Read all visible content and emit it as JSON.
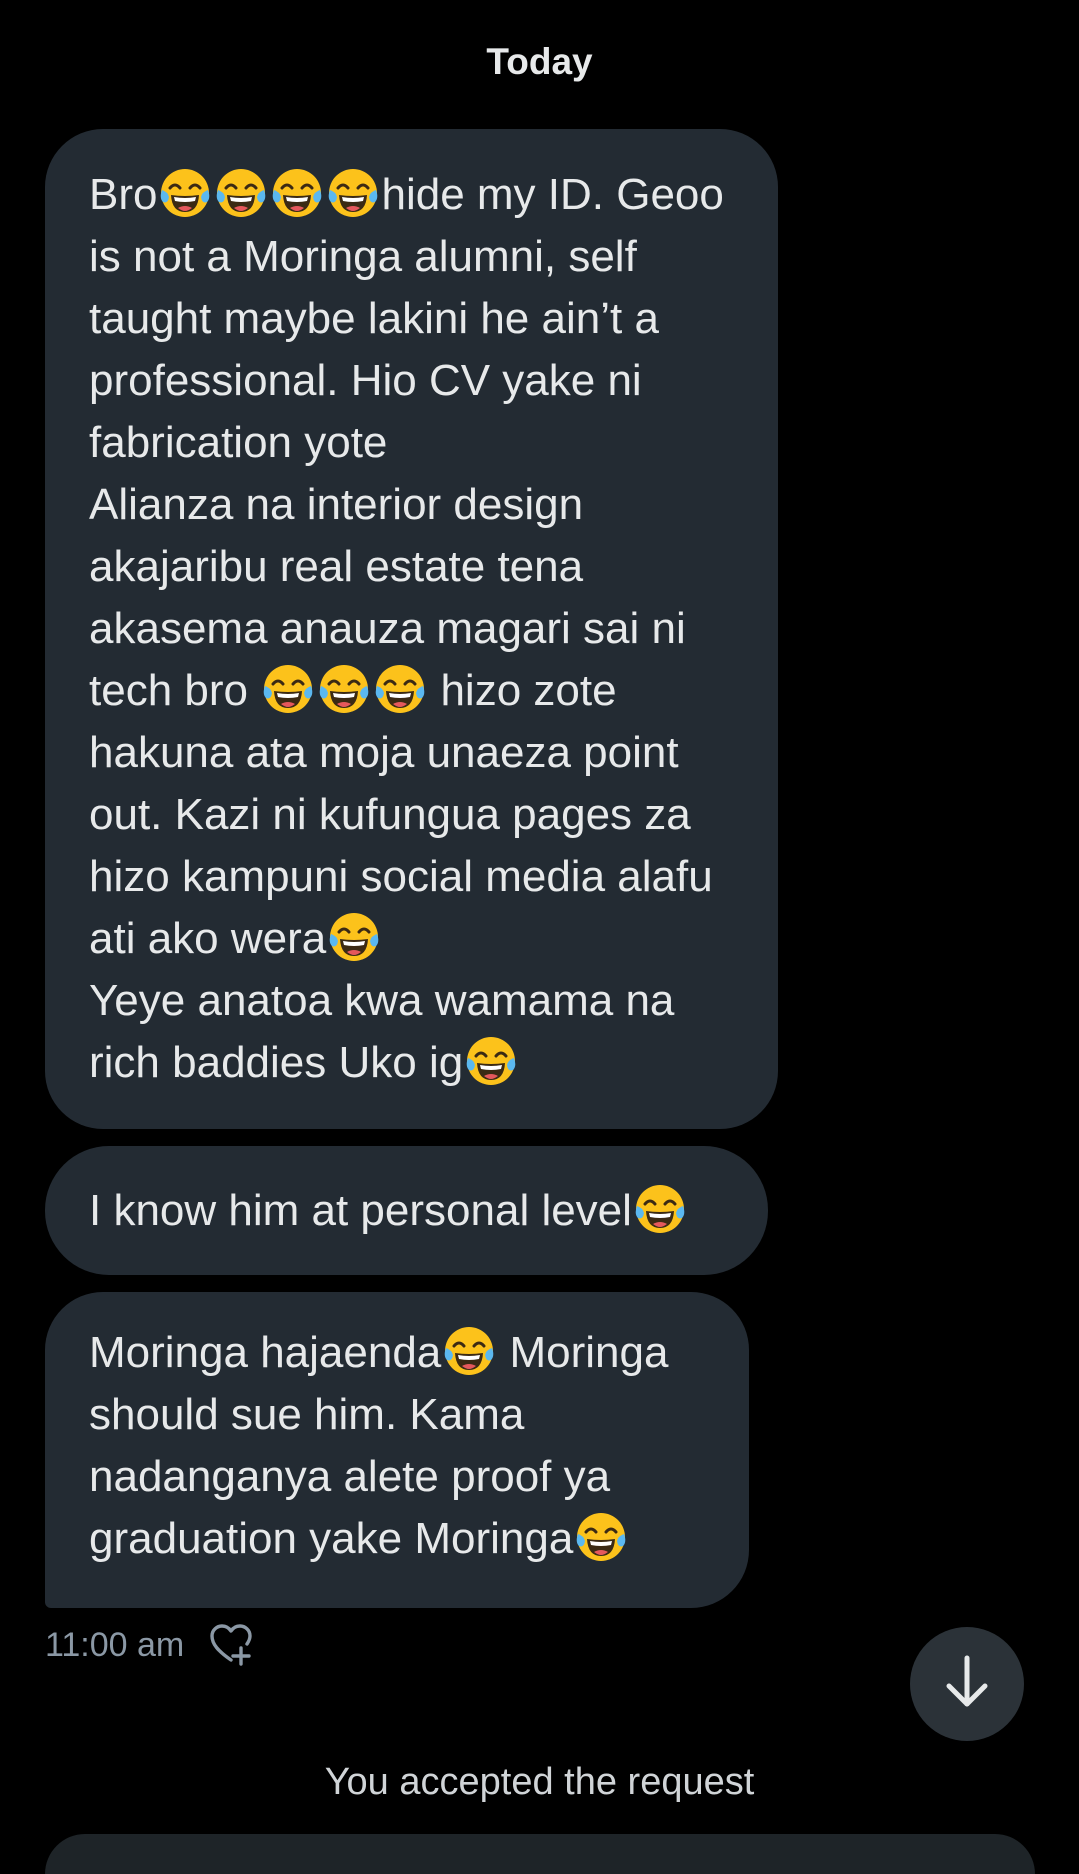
{
  "conversation": {
    "date_header": "Today",
    "messages": [
      {
        "id": "msg-1",
        "segments": [
          {
            "t": "text",
            "v": "Bro"
          },
          {
            "t": "emoji"
          },
          {
            "t": "emoji"
          },
          {
            "t": "emoji"
          },
          {
            "t": "emoji"
          },
          {
            "t": "text",
            "v": "hide my ID. Geoo is not a Moringa alumni, self taught maybe lakini he ain’t a professional. Hio CV yake ni fabrication yote\nAlianza na interior design akajaribu real estate tena akasema anauza magari sai ni tech bro "
          },
          {
            "t": "emoji"
          },
          {
            "t": "emoji"
          },
          {
            "t": "emoji"
          },
          {
            "t": "text",
            "v": " hizo zote hakuna ata moja unaeza point out. Kazi ni kufungua pages za hizo kampuni social media alafu ati ako wera"
          },
          {
            "t": "emoji"
          },
          {
            "t": "text",
            "v": "\nYeye anatoa kwa wamama na rich baddies Uko ig"
          },
          {
            "t": "emoji"
          }
        ]
      },
      {
        "id": "msg-2",
        "segments": [
          {
            "t": "text",
            "v": "I know him at personal level"
          },
          {
            "t": "emoji"
          }
        ]
      },
      {
        "id": "msg-3",
        "segments": [
          {
            "t": "text",
            "v": "Moringa hajaenda"
          },
          {
            "t": "emoji"
          },
          {
            "t": "text",
            "v": " Moringa should sue him. Kama nadanganya alete proof ya graduation yake Moringa"
          },
          {
            "t": "emoji"
          }
        ]
      }
    ],
    "emoji_name": "face-with-tears-of-joy",
    "timestamp": "11:00 am",
    "react_icon": "heart-plus-icon",
    "scroll_icon": "arrow-down-icon",
    "system_note": "You accepted the request"
  },
  "colors": {
    "background": "#000000",
    "bubble": "#232b33",
    "text": "#e7e9ea",
    "muted": "#8b98a5"
  }
}
